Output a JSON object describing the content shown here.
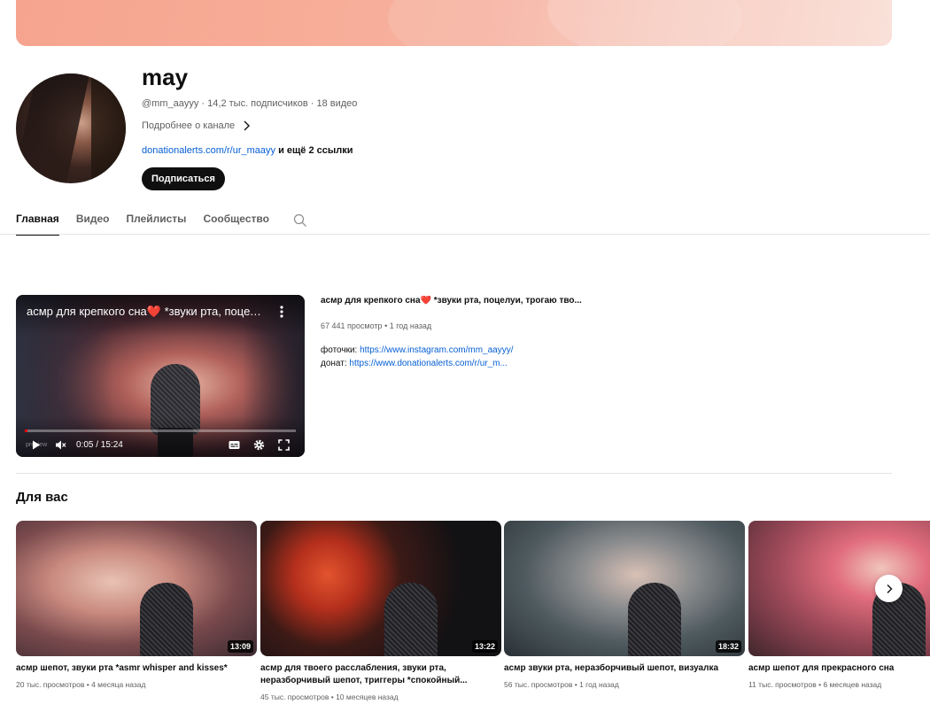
{
  "channel": {
    "name": "may",
    "handle": "@mm_aayyy",
    "subscribers": "14,2 тыс. подписчиков",
    "videos_count": "18 видео",
    "about_label": "Подробнее о канале",
    "link": "donationalerts.com/r/ur_maayy",
    "more_links": "и ещё 2 ссылки",
    "subscribe_label": "Подписаться"
  },
  "tabs": [
    {
      "label": "Главная",
      "active": true
    },
    {
      "label": "Видео",
      "active": false
    },
    {
      "label": "Плейлисты",
      "active": false
    },
    {
      "label": "Сообщество",
      "active": false
    }
  ],
  "featured": {
    "player_title": "асмр для крепкого сна❤️ *звуки рта, поцелуи, трогаю тво...",
    "time": "0:05 / 15:24",
    "progress": 0.005,
    "watermark": "preview",
    "title": "асмр для крепкого сна❤️ *звуки рта, поцелуи, трогаю тво...",
    "views": "67 441 просмотр",
    "age": "1 год назад",
    "desc_line1_label": "фоточки:",
    "desc_line1_link": "https://www.instagram.com/mm_aayyy/",
    "desc_line2_label": "донат:",
    "desc_line2_link": "https://www.donationalerts.com/r/ur_m..."
  },
  "for_you": {
    "title": "Для вас",
    "cards": [
      {
        "duration": "13:09",
        "title": "асмр шепот, звуки рта *asmr whisper and kisses*",
        "views": "20 тыс. просмотров",
        "age": "4 месяца назад"
      },
      {
        "duration": "13:22",
        "title": "асмр для твоего расслабления, звуки рта, неразборчивый шепот, триггеры *спокойный...",
        "views": "45 тыс. просмотров",
        "age": "10 месяцев назад"
      },
      {
        "duration": "18:32",
        "title": "асмр звуки рта, неразборчивый шепот, визуалка",
        "views": "56 тыс. просмотров",
        "age": "1 год назад"
      },
      {
        "duration": "",
        "title": "асмр шепот для прекрасного сна",
        "views": "11 тыс. просмотров",
        "age": "6 месяцев назад"
      }
    ]
  },
  "icons": {
    "search": "search-icon",
    "chevron": "chevron-right-icon",
    "play": "play-icon",
    "mute": "mute-icon",
    "subtitles": "subtitles-icon",
    "settings": "gear-icon",
    "fullscreen": "fullscreen-icon",
    "menu": "more-vert-icon",
    "next": "chevron-right-icon"
  },
  "colors": {
    "link": "#065fd4",
    "subscribe_bg": "#0f0f0f",
    "progress": "#ff0000"
  }
}
